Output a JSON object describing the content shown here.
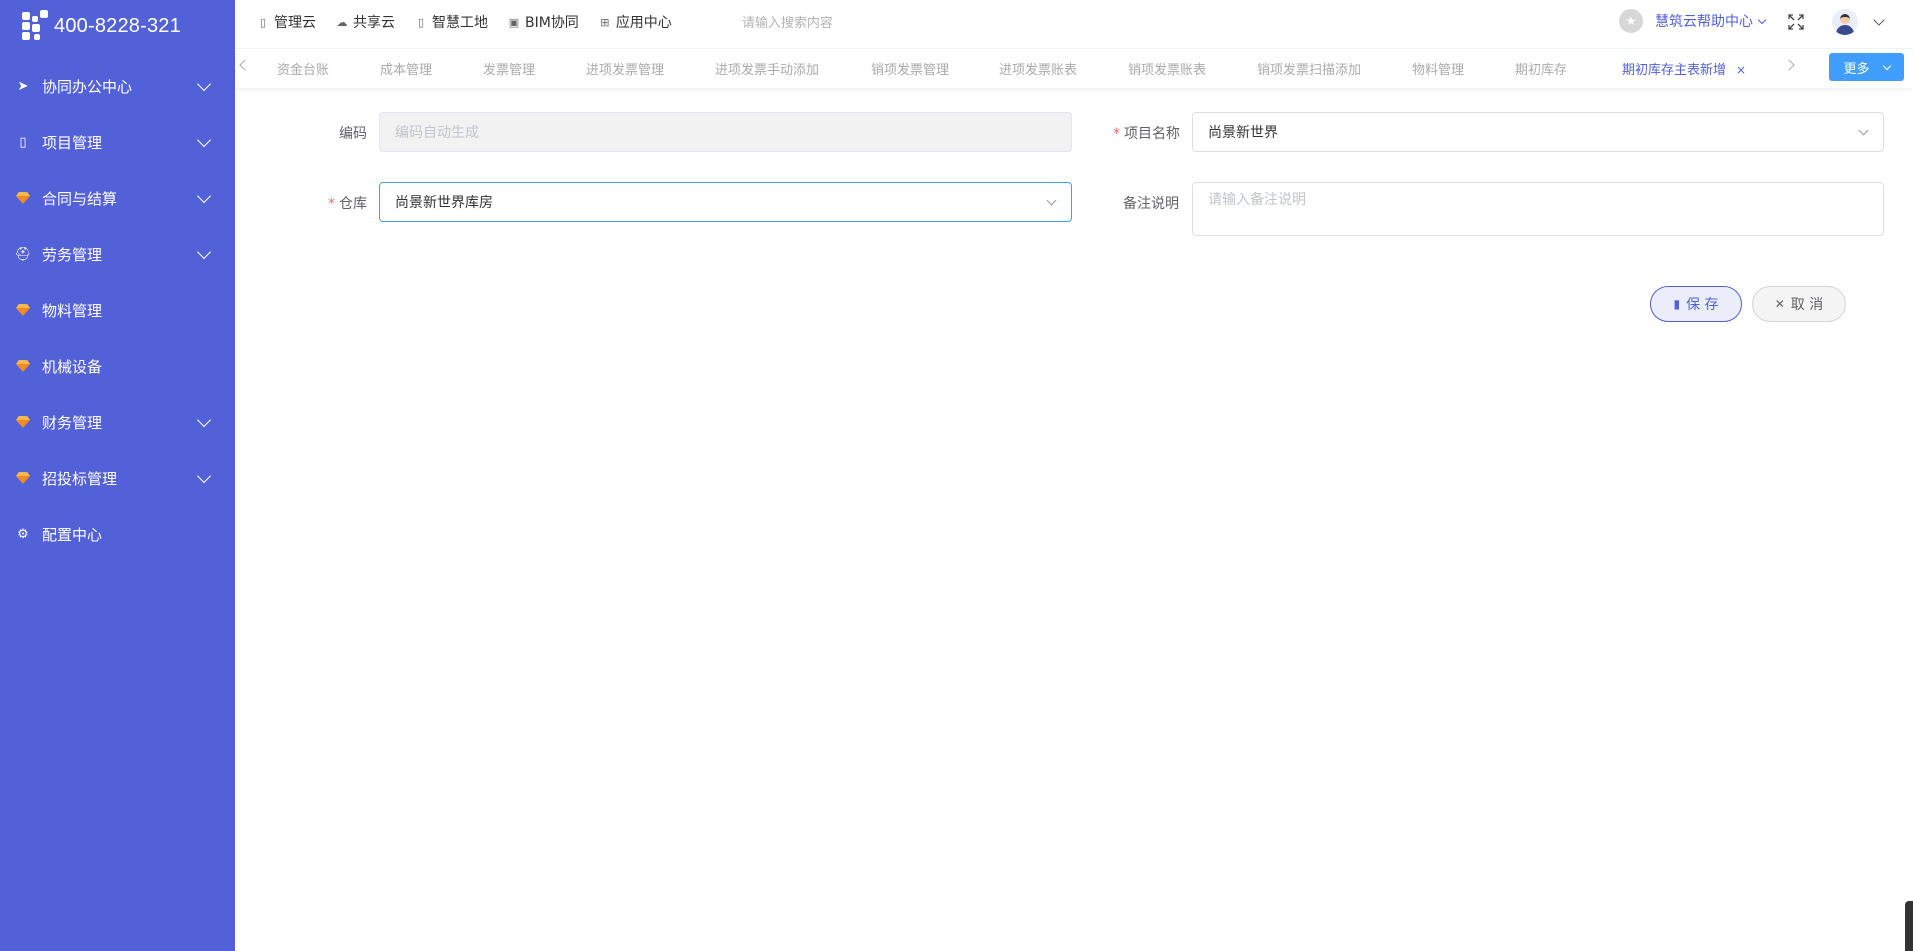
{
  "sidebar": {
    "logo_text": "400-8228-321",
    "items": [
      {
        "label": "协同办公中心",
        "icon": "send-icon",
        "expandable": true
      },
      {
        "label": "项目管理",
        "icon": "book-icon",
        "expandable": true
      },
      {
        "label": "合同与结算",
        "icon": "gem-icon",
        "expandable": true
      },
      {
        "label": "劳务管理",
        "icon": "worker-icon",
        "expandable": true
      },
      {
        "label": "物料管理",
        "icon": "gem-icon",
        "expandable": false
      },
      {
        "label": "机械设备",
        "icon": "gem-icon",
        "expandable": false
      },
      {
        "label": "财务管理",
        "icon": "gem-icon",
        "expandable": true
      },
      {
        "label": "招投标管理",
        "icon": "gem-icon",
        "expandable": true
      },
      {
        "label": "配置中心",
        "icon": "gear-icon",
        "expandable": false
      }
    ]
  },
  "topbar": {
    "nav": [
      {
        "label": "管理云",
        "icon": "book-icon"
      },
      {
        "label": "共享云",
        "icon": "cloud-icon"
      },
      {
        "label": "智慧工地",
        "icon": "book-icon"
      },
      {
        "label": "BIM协同",
        "icon": "cube-icon"
      },
      {
        "label": "应用中心",
        "icon": "grid-icon"
      }
    ],
    "search_placeholder": "请输入搜索内容",
    "help_label": "慧筑云帮助中心"
  },
  "tabs": {
    "items": [
      "资金台账",
      "成本管理",
      "发票管理",
      "进项发票管理",
      "进项发票手动添加",
      "销项发票管理",
      "进项发票账表",
      "销项发票账表",
      "销项发票扫描添加",
      "物料管理",
      "期初库存",
      "期初库存主表新增"
    ],
    "active": "期初库存主表新增",
    "close_glyph": "×",
    "more_label": "更多"
  },
  "form": {
    "code_label": "编码",
    "code_placeholder": "编码自动生成",
    "project_label": "项目名称",
    "project_value": "尚景新世界",
    "warehouse_label": "仓库",
    "warehouse_value": "尚景新世界库房",
    "remark_label": "备注说明",
    "remark_placeholder": "请输入备注说明",
    "required_mark": "*"
  },
  "actions": {
    "save_label": "保 存",
    "cancel_label": "取 消"
  },
  "colors": {
    "sidebar_bg": "#5361d8",
    "accent": "#5361d8",
    "more_button": "#409eff",
    "required": "#f56c6c"
  }
}
